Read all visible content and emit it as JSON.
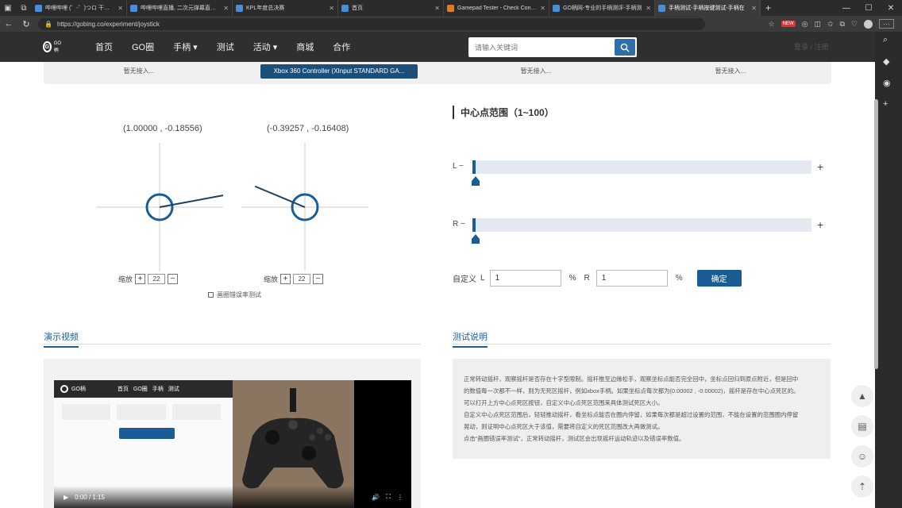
{
  "browser": {
    "tabs": [
      {
        "label": "哔哩哔哩 (゜-゜)つロ 干杯~-bili"
      },
      {
        "label": "哔哩哔哩直播, 二次元弹幕直播平"
      },
      {
        "label": "KPL年度总决赛"
      },
      {
        "label": "首页"
      },
      {
        "label": "Gamepad Tester - Check Control"
      },
      {
        "label": "GO柄网-专业的手柄测评-手柄测"
      },
      {
        "label": "手柄测试-手柄按键测试-手柄在"
      }
    ],
    "new_tab": "+",
    "url": "https://gobing.co/experiment/joystick",
    "badge_new": "NEW"
  },
  "site": {
    "logo_text": "GO柄",
    "nav": [
      "首页",
      "GO圈",
      "手柄 ▾",
      "测试",
      "活动 ▾",
      "商城",
      "合作"
    ],
    "search_placeholder": "请输入关键词",
    "nav_right": "登录 / 注册"
  },
  "controllers": {
    "slots": [
      "暂无接入...",
      "Xbox 360 Controller (XInput STANDARD GA...",
      "暂无接入...",
      "暂无接入..."
    ],
    "active_index": 1
  },
  "joystick": {
    "left": {
      "coord": "(1.00000 , -0.18556)",
      "x": 1.0,
      "y": -0.18556
    },
    "right": {
      "coord": "(-0.39257 , -0.16408)",
      "x": -0.39257,
      "y": -0.16408
    },
    "zoom_label": "缩放",
    "zoom_value_left": "22",
    "zoom_value_right": "22",
    "plus": "+",
    "minus": "−",
    "error_test_label": "画圈错误率测试"
  },
  "deadzone": {
    "title": "中心点范围（1~100）",
    "left_label": "L −",
    "right_label": "R −",
    "plus": "+",
    "left_value": 1,
    "right_value": 1,
    "custom_label": "自定义",
    "custom_L": "L",
    "custom_R": "R",
    "percent": "%",
    "left_input": "1",
    "right_input": "1",
    "confirm": "确定"
  },
  "sections": {
    "video_title": "演示视频",
    "desc_title": "测试说明"
  },
  "video": {
    "time": "0:00 / 1:15",
    "inner_logo": "GO柄",
    "inner_nav": [
      "首页",
      "GO圈",
      "手柄",
      "测试"
    ]
  },
  "description": {
    "lines": [
      "正常转动摇杆，观察摇杆是否存在十字型限制。摇杆推至边缘松手，观察坐标点能否完全回中，坐标点回归到原点附近，但是回中",
      "的数值每一次都不一样，则为无死区摇杆，例如xbox手柄。如果坐标点每次都为(0.00002 , -0.00002)，摇杆是存在中心点死区的。",
      "可以打开上方中心点死区按钮，自定义中心点死区范围来具体测试死区大小。",
      "自定义中心点死区范围后，轻轻推动摇杆，看坐标点能否在圈内停留，如果每次都是超过设置的范围，不能在设置的范围圈内停留",
      "晃动，则证明中心点死区大于该值，需要将自定义的死区范围改大再做测试。",
      "点击“画圈错误率测试”，正常转动摇杆，测试区会出现摇杆运动轨迹以及错误率数值。"
    ]
  },
  "colors": {
    "accent": "#1a5d94",
    "nav_bg": "#2f2f2f",
    "panel_bg": "#efefef"
  }
}
